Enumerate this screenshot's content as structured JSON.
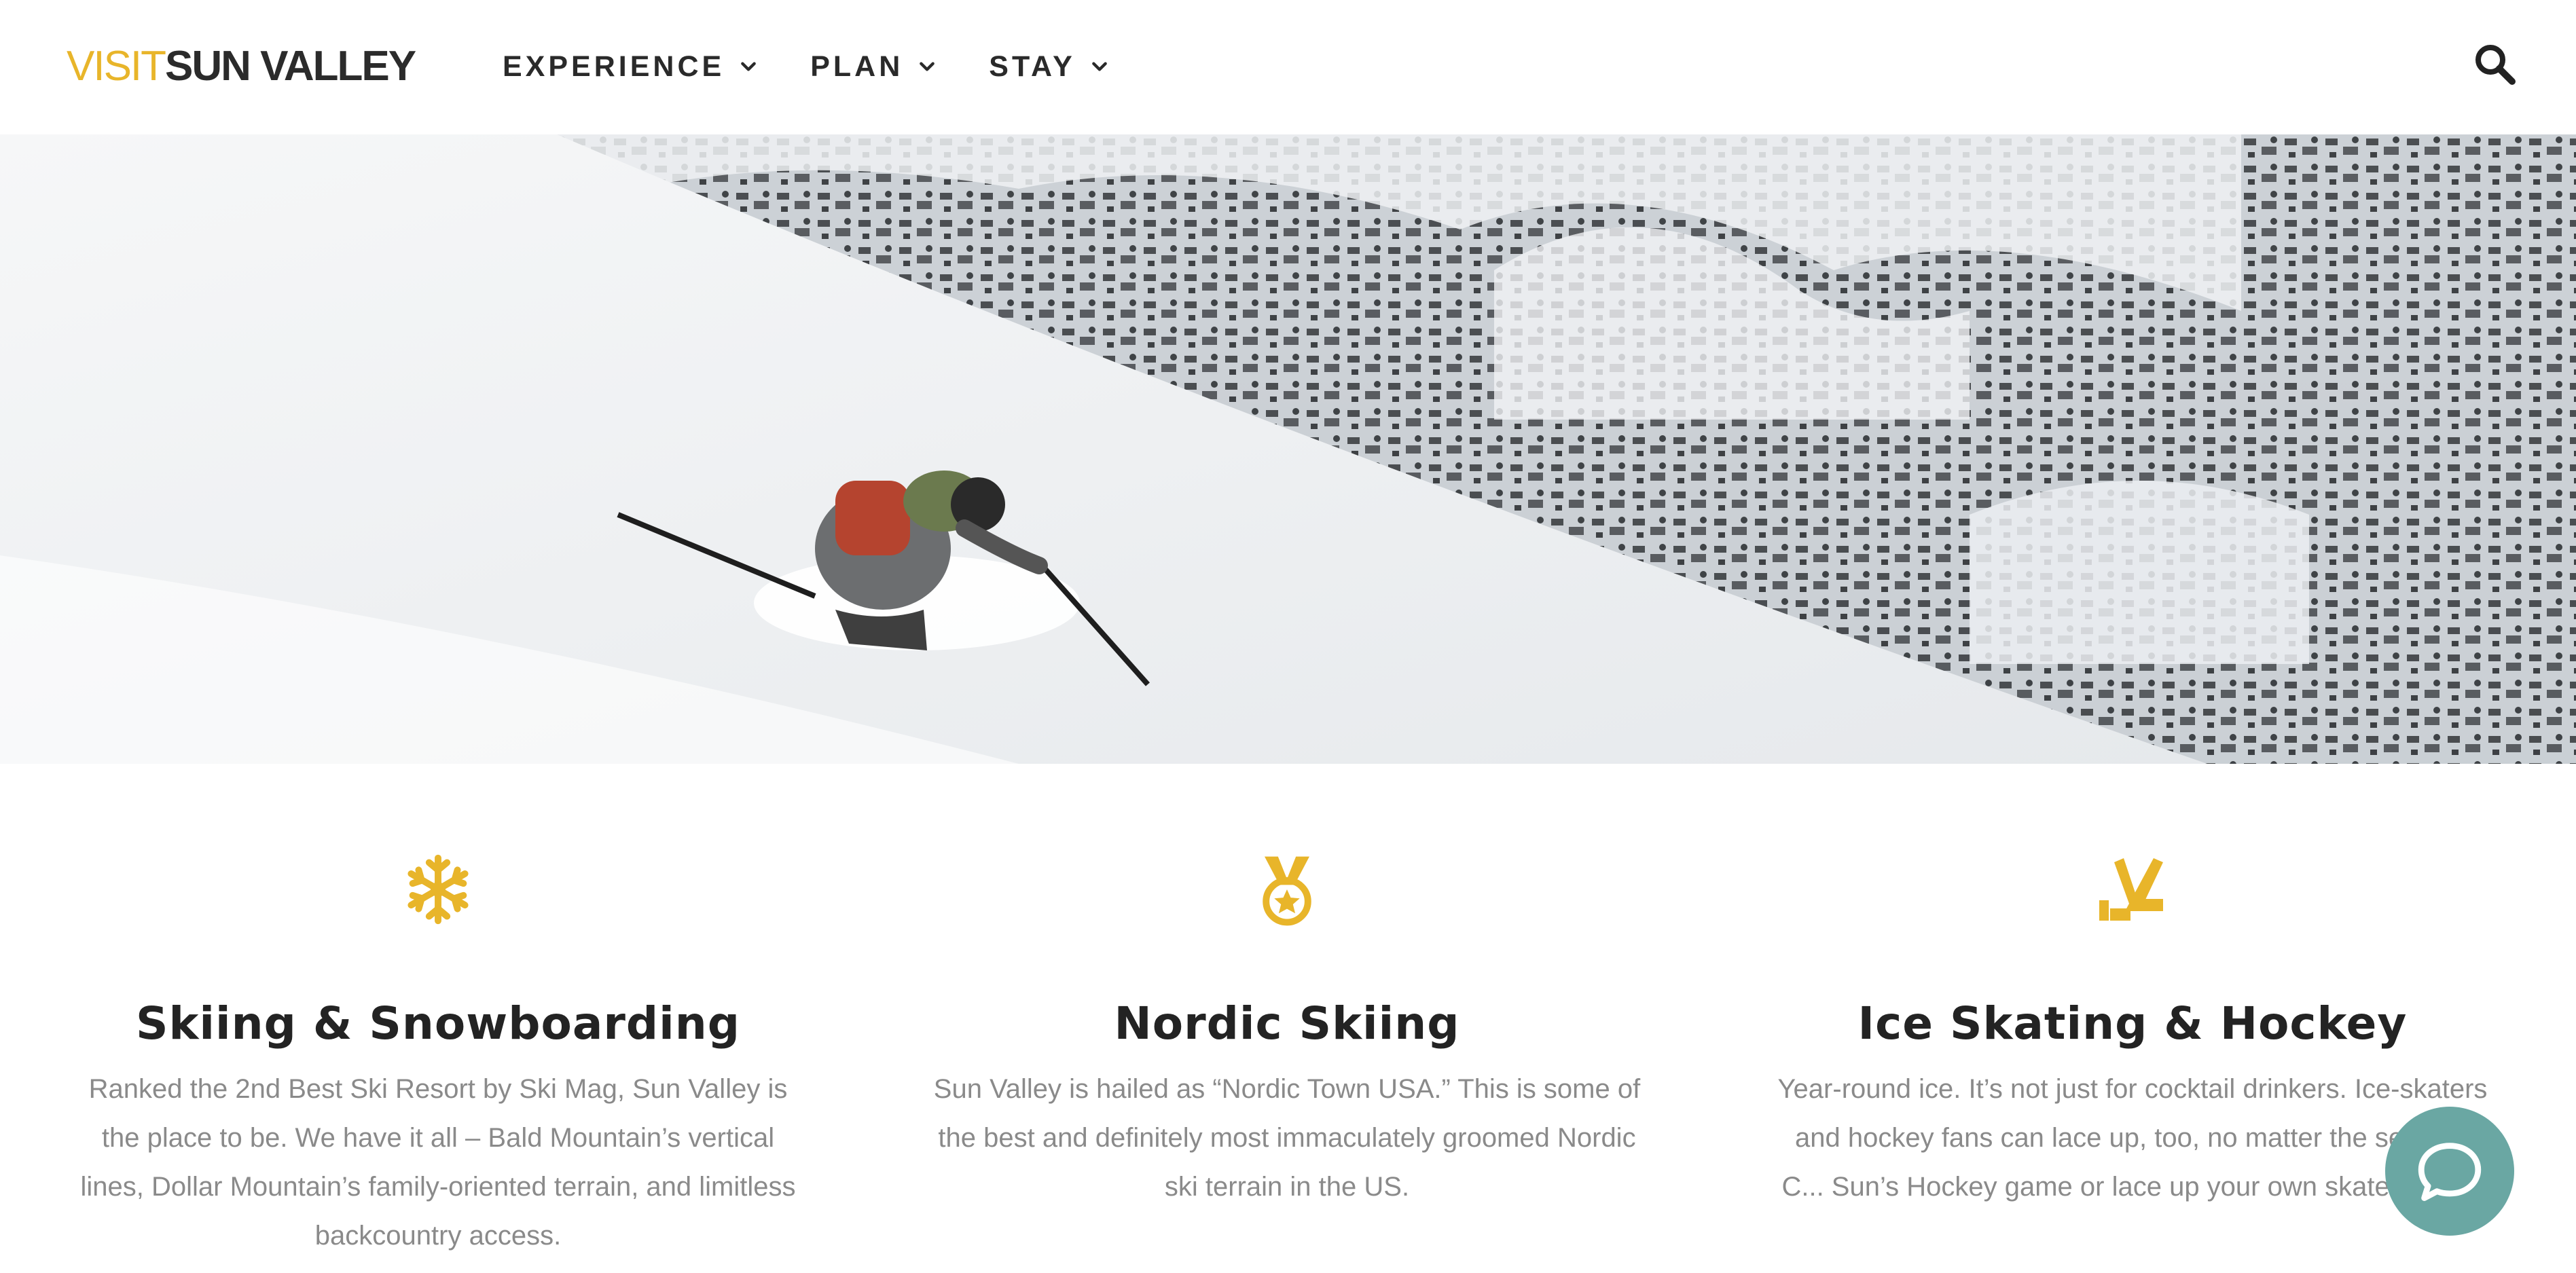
{
  "header": {
    "logo_visit": "VISIT",
    "logo_brand": "SUN VALLEY",
    "nav": [
      {
        "label": "EXPERIENCE"
      },
      {
        "label": "PLAN"
      },
      {
        "label": "STAY"
      }
    ],
    "search_icon": "search-icon"
  },
  "colors": {
    "accent": "#e8b52a",
    "heading": "#232323",
    "body_text": "#8a8a8a",
    "chat": "#6aa7a3"
  },
  "hero": {
    "description_icon": "skier-photo"
  },
  "features": [
    {
      "icon": "snowflake-icon",
      "title": "Skiing & Snowboarding",
      "text": "Ranked the 2nd Best Ski Resort by Ski Mag, Sun Valley is the place to be. We have it all – Bald Mountain’s vertical lines, Dollar Mountain’s family-oriented terrain, and limitless backcountry access."
    },
    {
      "icon": "medal-icon",
      "title": "Nordic Skiing",
      "text": "Sun Valley is hailed as “Nordic Town USA.” This is some of the best and definitely most immaculately groomed Nordic ski terrain in the US."
    },
    {
      "icon": "hockey-sticks-icon",
      "title": "Ice Skating & Hockey",
      "text": "Year-round ice. It’s not just for cocktail drinkers. Ice-skaters and hockey fans can lace up, too, no matter the season. C... Sun’s Hockey game or lace up your own skates this ..."
    }
  ],
  "chat": {
    "icon": "chat-bubble-icon"
  }
}
